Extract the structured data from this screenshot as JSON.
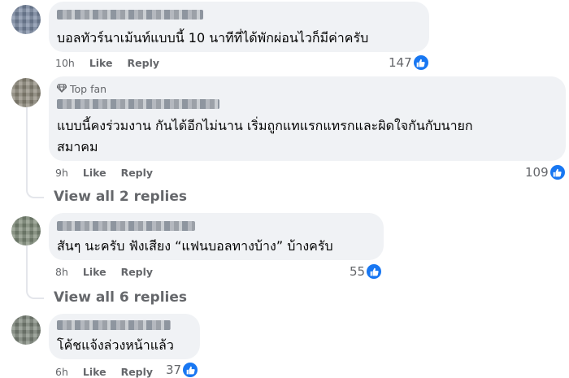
{
  "comments": [
    {
      "text": "บอลทัวร์นาเม้นท์แบบนี้ 10 นาทีที่ได้พักผ่อนไวก็มีค่าครับ",
      "time": "10h",
      "like_label": "Like",
      "reply_label": "Reply",
      "reactions": "147"
    },
    {
      "badge": "Top fan",
      "text_line1": "แบบนี้คงร่วมงาน กันได้อีกไม่นาน เริ่มถูกแทแรกแทรกและผิดใจกันกับนายก",
      "text_line2": "สมาคม",
      "time": "9h",
      "like_label": "Like",
      "reply_label": "Reply",
      "reactions": "109",
      "view_replies": "View all 2 replies"
    },
    {
      "text": "สันๆ นะครับ ฟังเสียง “แฟนบอลทางบ้าง” บ้างครับ",
      "time": "8h",
      "like_label": "Like",
      "reply_label": "Reply",
      "reactions": "55",
      "view_replies": "View all 6 replies"
    },
    {
      "text": "โค้ชแจ้งล่วงหน้าแล้ว",
      "time": "6h",
      "like_label": "Like",
      "reply_label": "Reply",
      "reactions": "37"
    }
  ],
  "colors": {
    "like_blue": "#1877f2",
    "bubble": "#f0f2f5",
    "meta": "#65676b"
  },
  "icons": {
    "reaction": "thumbs-up-icon",
    "top_fan": "diamond-icon"
  }
}
